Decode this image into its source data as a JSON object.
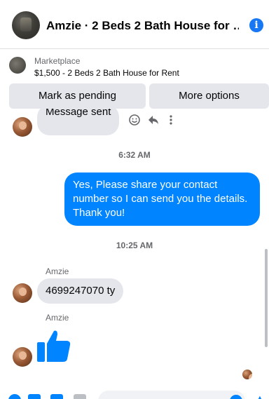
{
  "header": {
    "title": "Amzie · 2 Beds 2 Bath House for …",
    "info_icon": "i"
  },
  "marketplace": {
    "label": "Marketplace",
    "listing": "$1,500 - 2 Beds 2 Bath House for Rent",
    "buttons": {
      "pending": "Mark as pending",
      "more": "More options"
    }
  },
  "messages": {
    "first_in": "Message sent",
    "time_1": "6:32 AM",
    "out_1": "Yes, Please share your contact number so I can send you the details. Thank you!",
    "time_2": "10:25 AM",
    "sender_1": "Amzie",
    "in_2": "4699247070 ty",
    "sender_2": "Amzie"
  },
  "icons": {
    "info": "info-icon",
    "react": "smiley-icon",
    "reply": "reply-icon",
    "more": "more-vertical-icon",
    "thumbs_up": "thumbs-up-icon"
  },
  "colors": {
    "accent": "#0084ff",
    "brand": "#1877f2",
    "incoming_bubble": "#e4e6eb",
    "secondary_text": "#65676b"
  }
}
